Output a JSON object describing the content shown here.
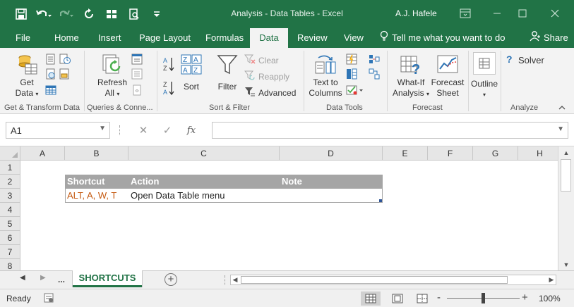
{
  "window": {
    "title": "Analysis - Data Tables  -  Excel",
    "user": "A.J. Hafele"
  },
  "tabs": [
    {
      "label": "File"
    },
    {
      "label": "Home"
    },
    {
      "label": "Insert"
    },
    {
      "label": "Page Layout"
    },
    {
      "label": "Formulas"
    },
    {
      "label": "Data"
    },
    {
      "label": "Review"
    },
    {
      "label": "View"
    }
  ],
  "tell_me": "Tell me what you want to do",
  "share": "Share",
  "ribbon": {
    "get_data": {
      "line1": "Get",
      "line2": "Data"
    },
    "refresh_all": {
      "line1": "Refresh",
      "line2": "All"
    },
    "sort": "Sort",
    "filter": "Filter",
    "clear": "Clear",
    "reapply": "Reapply",
    "advanced": "Advanced",
    "text_to_columns": {
      "line1": "Text to",
      "line2": "Columns"
    },
    "what_if": {
      "line1": "What-If",
      "line2": "Analysis"
    },
    "forecast_sheet": {
      "line1": "Forecast",
      "line2": "Sheet"
    },
    "outline": "Outline",
    "solver": "Solver",
    "groups": {
      "get_transform": "Get & Transform Data",
      "queries": "Queries & Conne...",
      "sort_filter": "Sort & Filter",
      "data_tools": "Data Tools",
      "forecast": "Forecast",
      "analyze": "Analyze"
    }
  },
  "formula_bar": {
    "name_box": "A1",
    "fx": "fx",
    "value": ""
  },
  "columns": [
    "A",
    "B",
    "C",
    "D",
    "E",
    "F",
    "G",
    "H"
  ],
  "rows": [
    "1",
    "2",
    "3",
    "4",
    "5",
    "6",
    "7",
    "8"
  ],
  "table": {
    "headers": [
      "Shortcut",
      "Action",
      "Note"
    ],
    "rows": [
      [
        "ALT, A, W, T",
        "Open Data Table menu",
        ""
      ]
    ]
  },
  "sheets": {
    "ellipsis": "...",
    "active": "SHORTCUTS"
  },
  "status": {
    "ready": "Ready",
    "zoom": "100%",
    "zoom_minus": "-",
    "zoom_plus": "+"
  },
  "colors": {
    "brand": "#217346",
    "table_header": "#a5a5a5",
    "shortcut_text": "#c55a11"
  }
}
